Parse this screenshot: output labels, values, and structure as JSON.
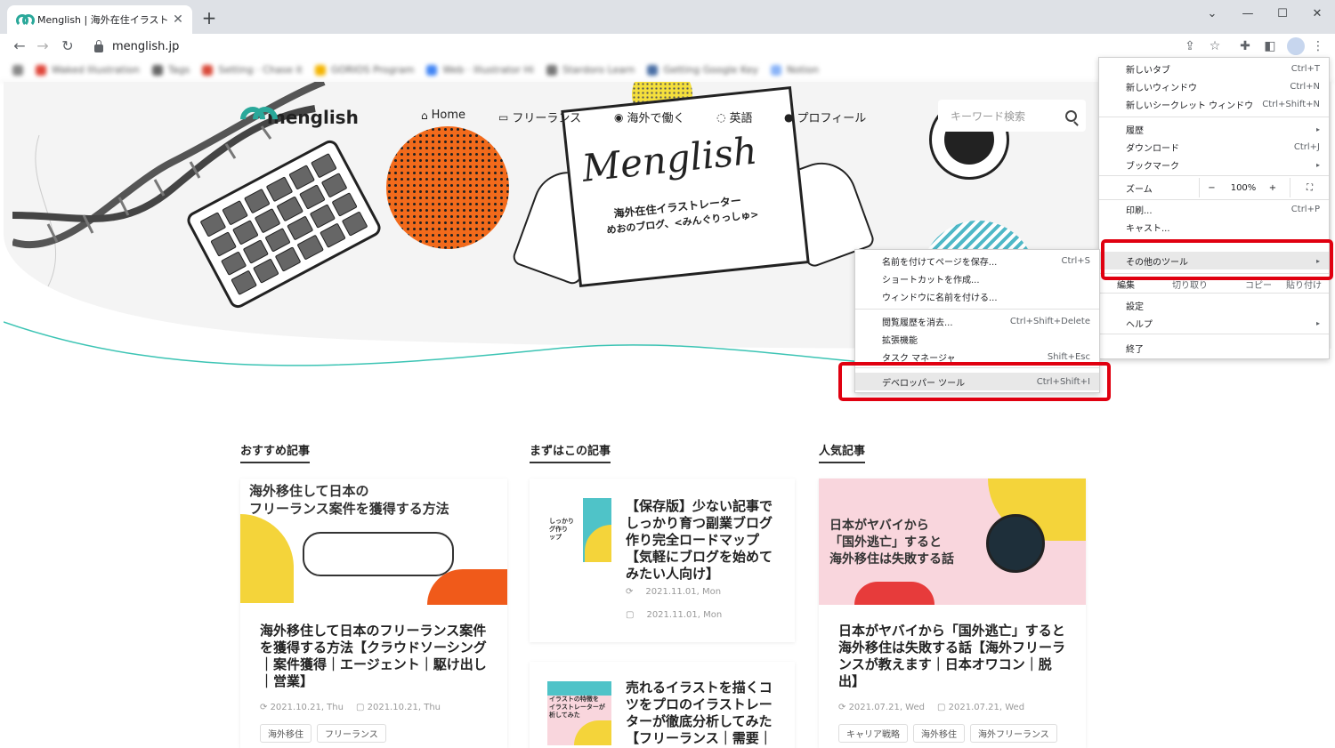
{
  "browser": {
    "tab_title": "Menglish | 海外在住イラストレーター",
    "tab_close": "✕",
    "new_tab": "+",
    "url": "menglish.jp",
    "window_controls": [
      "⌄",
      "—",
      "☐",
      "✕"
    ],
    "bookmarks": [
      {
        "label": "Waked Illustration",
        "color": "#e0463a"
      },
      {
        "label": "Tags",
        "color": "#666666"
      },
      {
        "label": "Setting · Chase it",
        "color": "#d94a3a"
      },
      {
        "label": "GORIOS Program",
        "color": "#f4b400"
      },
      {
        "label": "Web · Illustrator Hi",
        "color": "#4285f4"
      },
      {
        "label": "Stardoro Learn",
        "color": "#777777"
      },
      {
        "label": "Getting Google Key",
        "color": "#4a6fa5"
      },
      {
        "label": "Notion",
        "color": "#8ab4f8"
      }
    ]
  },
  "site": {
    "logo": "menglish",
    "nav": [
      {
        "icon": "⌂",
        "label": "Home"
      },
      {
        "icon": "▭",
        "label": "フリーランス"
      },
      {
        "icon": "◉",
        "label": "海外で働く"
      },
      {
        "icon": "◌",
        "label": "英語"
      },
      {
        "icon": "●",
        "label": "プロフィール"
      }
    ],
    "search_placeholder": "キーワード検索",
    "hero": {
      "script": "Menglish",
      "line1": "海外在住イラストレーター",
      "line2": "めおのブログ、<みんぐりっしゅ>"
    },
    "sections": [
      {
        "heading": "おすすめ記事",
        "img_text": "海外移住して日本の\nフリーランス案件を獲得する方法",
        "title": "海外移住して日本のフリーランス案件を獲得する方法【クラウドソーシング｜案件獲得｜エージェント｜駆け出し｜営業】",
        "updated": "2021.10.21, Thu",
        "published": "2021.10.21, Thu",
        "tags": [
          "海外移住",
          "フリーランス"
        ]
      },
      {
        "heading": "まずはこの記事",
        "img_text": "しっかり\nグ作り\nップ",
        "title": "【保存版】少ない記事でしっかり育つ副業ブログ作り完全ロードマップ【気軽にブログを始めてみたい人向け】",
        "updated": "2021.11.01, Mon",
        "published": "2021.11.01, Mon",
        "img2_text": "イラストの特徴を\nイラストレーターが\n析してみた",
        "title2": "売れるイラストを描くコツをプロのイラストレーターが徹底分析してみた【フリーランス｜需要｜"
      },
      {
        "heading": "人気記事",
        "img_text": "日本がヤバイから\n「国外逃亡」すると\n海外移住は失敗する話",
        "title": "日本がヤバイから「国外逃亡」すると海外移住は失敗する話【海外フリーランスが教えます｜日本オワコン｜脱出】",
        "updated": "2021.07.21, Wed",
        "published": "2021.07.21, Wed",
        "tags": [
          "キャリア戦略",
          "海外移住",
          "海外フリーランス"
        ]
      }
    ]
  },
  "chrome_menu": {
    "items": [
      {
        "label": "新しいタブ",
        "shortcut": "Ctrl+T"
      },
      {
        "label": "新しいウィンドウ",
        "shortcut": "Ctrl+N"
      },
      {
        "label": "新しいシークレット ウィンドウ",
        "shortcut": "Ctrl+Shift+N"
      },
      {
        "label": "履歴",
        "shortcut": "▸"
      },
      {
        "label": "ダウンロード",
        "shortcut": "Ctrl+J"
      },
      {
        "label": "ブックマーク",
        "shortcut": "▸"
      }
    ],
    "zoom_label": "ズーム",
    "zoom_minus": "−",
    "zoom_value": "100%",
    "zoom_plus": "+",
    "zoom_full": "⛶",
    "print": {
      "label": "印刷...",
      "shortcut": "Ctrl+P"
    },
    "cast": {
      "label": "キャスト..."
    },
    "more_tools": {
      "label": "その他のツール",
      "shortcut": "▸"
    },
    "edit": {
      "label": "編集",
      "cut": "切り取り",
      "copy": "コピー",
      "paste": "貼り付け"
    },
    "settings": "設定",
    "help": {
      "label": "ヘルプ",
      "shortcut": "▸"
    },
    "exit": "終了"
  },
  "submenu": {
    "items": [
      {
        "label": "名前を付けてページを保存...",
        "shortcut": "Ctrl+S"
      },
      {
        "label": "ショートカットを作成...",
        "shortcut": ""
      },
      {
        "label": "ウィンドウに名前を付ける...",
        "shortcut": ""
      },
      {
        "label": "閲覧履歴を消去...",
        "shortcut": "Ctrl+Shift+Delete"
      },
      {
        "label": "拡張機能",
        "shortcut": ""
      },
      {
        "label": "タスク マネージャ",
        "shortcut": "Shift+Esc"
      },
      {
        "label": "デベロッパー ツール",
        "shortcut": "Ctrl+Shift+I"
      }
    ]
  },
  "colors": {
    "accent": "#2aa89a",
    "highlight_box": "#e00010"
  }
}
